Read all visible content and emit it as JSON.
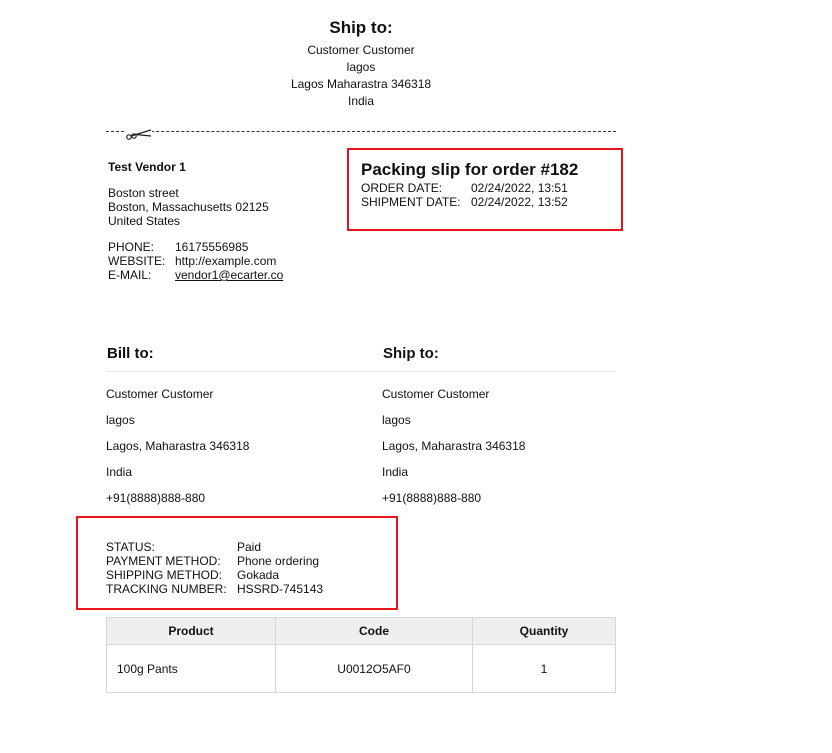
{
  "top_ship": {
    "title": "Ship to:",
    "name": "Customer Customer",
    "line1": "lagos",
    "line2": "Lagos Maharastra 346318",
    "country": "India"
  },
  "vendor": {
    "name": "Test Vendor 1",
    "street": "Boston street",
    "city": "Boston, Massachusetts 02125",
    "country": "United States",
    "phone_label": "PHONE:",
    "phone": "16175556985",
    "website_label": "WEBSITE:",
    "website": "http://example.com",
    "email_label": "E-MAIL:",
    "email": "vendor1@ecarter.co"
  },
  "slip": {
    "title": "Packing slip for order #182",
    "order_date_label": "ORDER DATE:",
    "order_date": "02/24/2022, 13:51",
    "shipment_date_label": "SHIPMENT DATE:",
    "shipment_date": "02/24/2022, 13:52"
  },
  "bill_to": {
    "title": "Bill to:",
    "name": "Customer Customer",
    "line1": "lagos",
    "line2": "Lagos, Maharastra 346318",
    "country": "India",
    "phone": "+91(8888)888-880"
  },
  "ship_to": {
    "title": "Ship to:",
    "name": "Customer Customer",
    "line1": "lagos",
    "line2": "Lagos, Maharastra 346318",
    "country": "India",
    "phone": "+91(8888)888-880"
  },
  "status": {
    "status_label": "STATUS:",
    "status": "Paid",
    "payment_label": "PAYMENT METHOD:",
    "payment": "Phone ordering",
    "shipping_label": "SHIPPING METHOD:",
    "shipping": "Gokada",
    "tracking_label": "TRACKING NUMBER:",
    "tracking": "HSSRD-745143"
  },
  "items": {
    "headers": [
      "Product",
      "Code",
      "Quantity"
    ],
    "rows": [
      {
        "product": "100g Pants",
        "code": "U0012O5AF0",
        "quantity": "1"
      }
    ]
  },
  "colors": {
    "highlight": "#e8141c"
  },
  "icons": {
    "cut": "scissors-icon"
  }
}
